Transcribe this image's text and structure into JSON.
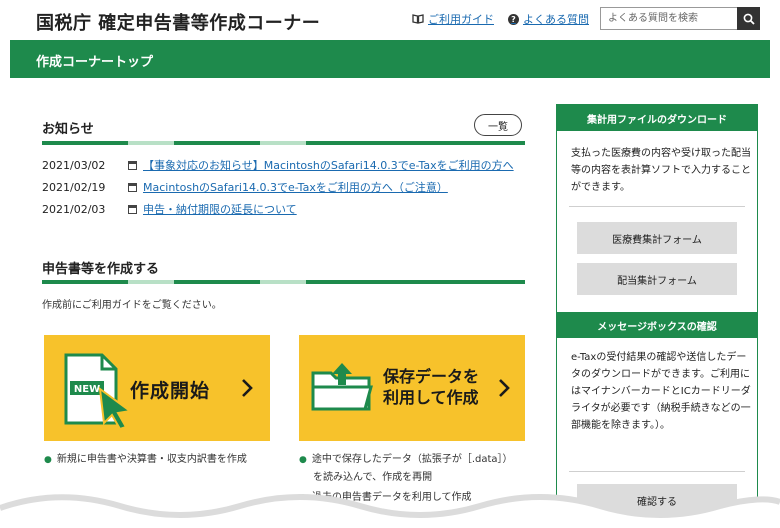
{
  "header": {
    "site_title": "国税庁 確定申告書等作成コーナー",
    "guide_link": "ご利用ガイド",
    "faq_link": "よくある質問",
    "search_placeholder": "よくある質問を検索"
  },
  "greenbar": {
    "title": "作成コーナートップ"
  },
  "news": {
    "heading": "お知らせ",
    "list_button": "一覧",
    "items": [
      {
        "date": "2021/03/02",
        "text": "【事象対応のお知らせ】MacintoshのSafari14.0.3でe-Taxをご利用の方へ"
      },
      {
        "date": "2021/02/19",
        "text": "MacintoshのSafari14.0.3でe-Taxをご利用の方へ（ご注意）"
      },
      {
        "date": "2021/02/03",
        "text": "申告・納付期限の延長について"
      }
    ]
  },
  "create": {
    "heading": "申告書等を作成する",
    "lead": "作成前にご利用ガイドをご覧ください。",
    "card_new": {
      "badge": "NEW",
      "label": "作成開始"
    },
    "card_saved": {
      "line1": "保存データを",
      "line2": "利用して作成"
    },
    "bullet_new": "新規に申告書や決算書・収支内訳書を作成",
    "bullet_saved_1": "途中で保存したデータ（拡張子が［.data］）",
    "bullet_saved_2": "を読み込んで、作成を再開",
    "bullet_saved_3": "過去の申告書データを利用して作成"
  },
  "sidebar": {
    "download": {
      "heading": "集計用ファイルのダウンロード",
      "text": "支払った医療費の内容や受け取った配当等の内容を表計算ソフトで入力することができます。",
      "button_medical": "医療費集計フォーム",
      "button_dividend": "配当集計フォーム"
    },
    "messagebox": {
      "heading": "メッセージボックスの確認",
      "text": "e-Taxの受付結果の確認や送信したデータのダウンロードができます。ご利用にはマイナンバーカードとICカードリーダライタが必要です（納税手続きなどの一部機能を除きます。）。",
      "button_confirm": "確認する"
    }
  },
  "colors": {
    "brand_green": "#1e8a4c",
    "card_yellow": "#f7c22b",
    "link_blue": "#1a6ab0"
  },
  "icons": [
    "book-icon",
    "question-icon",
    "search-icon",
    "document-icon",
    "new-document-icon",
    "cursor-arrow-icon",
    "folder-upload-icon",
    "chevron-right-icon"
  ]
}
